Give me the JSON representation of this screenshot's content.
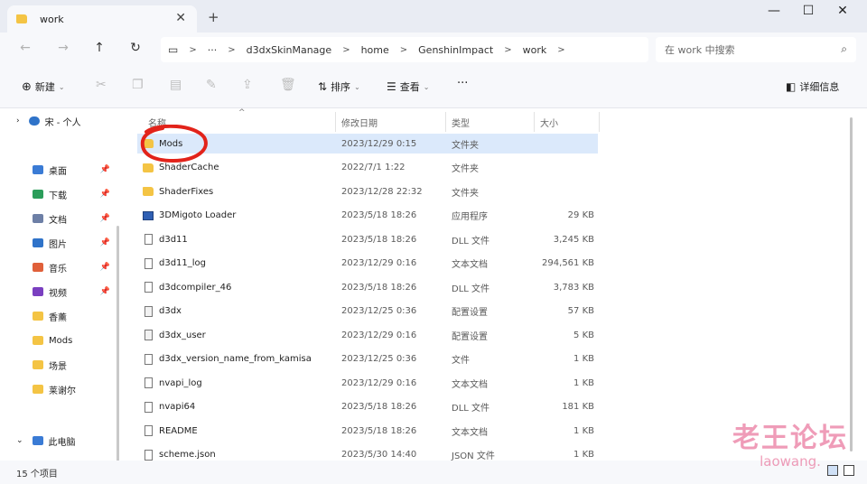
{
  "window": {
    "tab_title": "work",
    "tab_close": "✕",
    "new_tab": "+",
    "minimize": "—",
    "maximize": "☐",
    "close": "✕"
  },
  "nav": {
    "back": "←",
    "forward": "→",
    "up": "↑",
    "refresh": "↻"
  },
  "address": {
    "more": "···",
    "crumbs": [
      "d3dxSkinManage",
      "home",
      "GenshinImpact",
      "work"
    ],
    "sep": ">"
  },
  "search": {
    "placeholder": "在 work 中搜索"
  },
  "toolbar": {
    "new_label": "新建",
    "sort_label": "排序",
    "view_label": "查看",
    "more_label": "···",
    "details_label": "详细信息"
  },
  "sidebar": {
    "onedrive": "宋 - 个人",
    "items": [
      {
        "label": "桌面",
        "icon": "desktop-icon",
        "color": "#3a7bd5",
        "pinned": true
      },
      {
        "label": "下载",
        "icon": "download-icon",
        "color": "#2b9d5a",
        "pinned": true
      },
      {
        "label": "文档",
        "icon": "documents-icon",
        "color": "#6d7fa6",
        "pinned": true
      },
      {
        "label": "图片",
        "icon": "pictures-icon",
        "color": "#2f73c9",
        "pinned": true
      },
      {
        "label": "音乐",
        "icon": "music-icon",
        "color": "#e0603a",
        "pinned": true
      },
      {
        "label": "视频",
        "icon": "videos-icon",
        "color": "#7a3fc0",
        "pinned": true
      },
      {
        "label": "香薰",
        "icon": "folder-icon",
        "color": "#f4c444",
        "pinned": false
      },
      {
        "label": "Mods",
        "icon": "folder-icon",
        "color": "#f4c444",
        "pinned": false
      },
      {
        "label": "场景",
        "icon": "folder-icon",
        "color": "#f4c444",
        "pinned": false
      },
      {
        "label": "莱谢尔",
        "icon": "folder-icon",
        "color": "#f4c444",
        "pinned": false
      }
    ],
    "this_pc": "此电脑"
  },
  "columns": {
    "name": "名称",
    "date": "修改日期",
    "type": "类型",
    "size": "大小"
  },
  "files": [
    {
      "name": "Mods",
      "date": "2023/12/29 0:15",
      "type": "文件夹",
      "size": "",
      "icon": "folder"
    },
    {
      "name": "ShaderCache",
      "date": "2022/7/1 1:22",
      "type": "文件夹",
      "size": "",
      "icon": "folder"
    },
    {
      "name": "ShaderFixes",
      "date": "2023/12/28 22:32",
      "type": "文件夹",
      "size": "",
      "icon": "folder"
    },
    {
      "name": "3DMigoto Loader",
      "date": "2023/5/18 18:26",
      "type": "应用程序",
      "size": "29 KB",
      "icon": "app"
    },
    {
      "name": "d3d11",
      "date": "2023/5/18 18:26",
      "type": "DLL 文件",
      "size": "3,245 KB",
      "icon": "file"
    },
    {
      "name": "d3d11_log",
      "date": "2023/12/29 0:16",
      "type": "文本文档",
      "size": "294,561 KB",
      "icon": "file"
    },
    {
      "name": "d3dcompiler_46",
      "date": "2023/5/18 18:26",
      "type": "DLL 文件",
      "size": "3,783 KB",
      "icon": "file"
    },
    {
      "name": "d3dx",
      "date": "2023/12/25 0:36",
      "type": "配置设置",
      "size": "57 KB",
      "icon": "cfg"
    },
    {
      "name": "d3dx_user",
      "date": "2023/12/29 0:16",
      "type": "配置设置",
      "size": "5 KB",
      "icon": "cfg"
    },
    {
      "name": "d3dx_version_name_from_kamisa",
      "date": "2023/12/25 0:36",
      "type": "文件",
      "size": "1 KB",
      "icon": "file"
    },
    {
      "name": "nvapi_log",
      "date": "2023/12/29 0:16",
      "type": "文本文档",
      "size": "1 KB",
      "icon": "file"
    },
    {
      "name": "nvapi64",
      "date": "2023/5/18 18:26",
      "type": "DLL 文件",
      "size": "181 KB",
      "icon": "file"
    },
    {
      "name": "README",
      "date": "2023/5/18 18:26",
      "type": "文本文档",
      "size": "1 KB",
      "icon": "file"
    },
    {
      "name": "scheme.json",
      "date": "2023/5/30 14:40",
      "type": "JSON 文件",
      "size": "1 KB",
      "icon": "file"
    }
  ],
  "selected_file": "Mods",
  "status": {
    "count": "15 个项目"
  },
  "watermark": {
    "cn": "老王论坛",
    "en": "laowang."
  },
  "colors": {
    "selection": "#dbe9fb",
    "annotation": "#e2231a",
    "watermark": "#e65c8a"
  }
}
